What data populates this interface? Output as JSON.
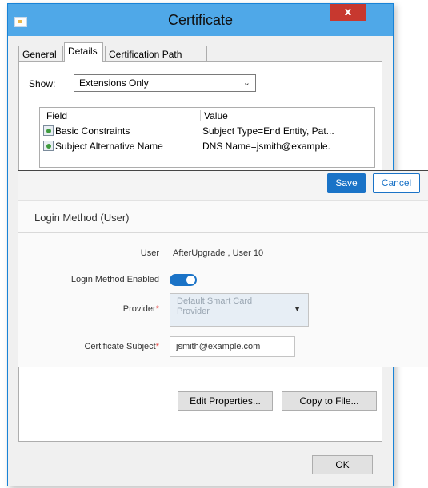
{
  "window": {
    "title": "Certificate",
    "close_glyph": "x",
    "tabs": [
      {
        "label": "General",
        "active": false
      },
      {
        "label": "Details",
        "active": true
      },
      {
        "label": "Certification Path",
        "active": false
      }
    ],
    "show": {
      "label": "Show:",
      "value": "Extensions Only"
    },
    "list": {
      "columns": [
        "Field",
        "Value"
      ],
      "rows": [
        {
          "field": "Basic Constraints",
          "value": "Subject Type=End Entity, Pat..."
        },
        {
          "field": "Subject Alternative Name",
          "value": "DNS Name=jsmith@example."
        }
      ]
    },
    "buttons": {
      "edit_properties": "Edit Properties...",
      "copy_to_file": "Copy to File...",
      "ok": "OK"
    }
  },
  "overlay": {
    "save_label": "Save",
    "cancel_label": "Cancel",
    "section_title": "Login Method (User)",
    "fields": {
      "user_label": "User",
      "user_value": "AfterUpgrade , User 10",
      "enabled_label": "Login Method Enabled",
      "enabled": true,
      "provider_label": "Provider",
      "provider_value": "Default Smart Card Provider",
      "subject_label": "Certificate Subject",
      "subject_value": "jsmith@example.com",
      "required_mark": "*"
    }
  },
  "colors": {
    "titlebar": "#4fa8e8",
    "close": "#c7382f",
    "accent": "#1a73c7",
    "required": "#e53935"
  }
}
